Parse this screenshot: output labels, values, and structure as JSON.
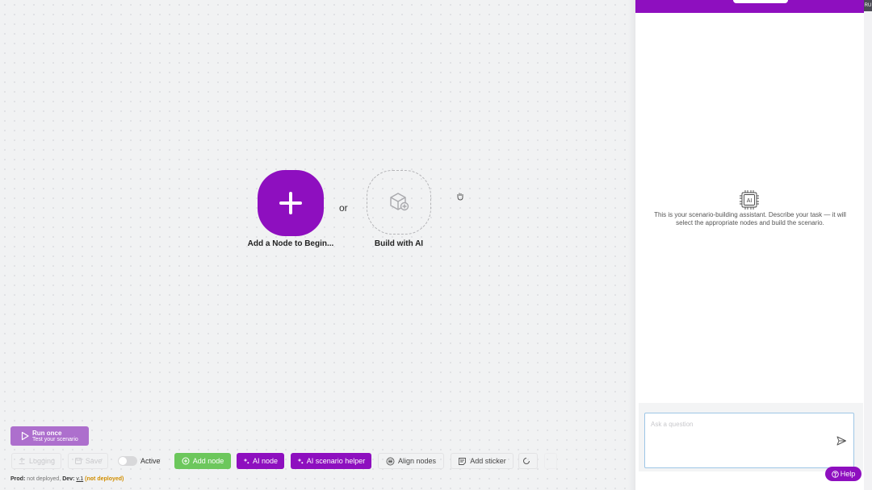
{
  "canvas": {
    "add_node_label": "Add a Node to Begin...",
    "or_label": "or",
    "build_ai_label": "Build with AI"
  },
  "toolbar": {
    "run_once_title": "Run once",
    "run_once_subtitle": "Test your scenario",
    "ghost_button_1": "Logging",
    "ghost_button_2": "Save",
    "active_label": "Active",
    "add_node": "Add node",
    "ai_node": "AI node",
    "ai_scenario_helper": "AI scenario helper",
    "align_nodes": "Align nodes",
    "add_sticker": "Add sticker"
  },
  "status": {
    "prod_label": "Prod:",
    "prod_value": "not deployed,",
    "dev_label": "Dev:",
    "dev_version": "v.1",
    "dev_value": "(not deployed)"
  },
  "assistant": {
    "chip_label": "AI",
    "description": "This is your scenario-building assistant. Describe your task — it will select the appropriate nodes and build the scenario.",
    "input_placeholder": "Ask a question",
    "input_value": ""
  },
  "strip": {
    "tab_label": "RU"
  },
  "help": {
    "label": "Help"
  },
  "colors": {
    "brand_purple": "#8e0fbf",
    "run_once_purple": "#ad6fcd",
    "add_node_green": "#6cc75c",
    "status_warning": "#d28f00"
  }
}
